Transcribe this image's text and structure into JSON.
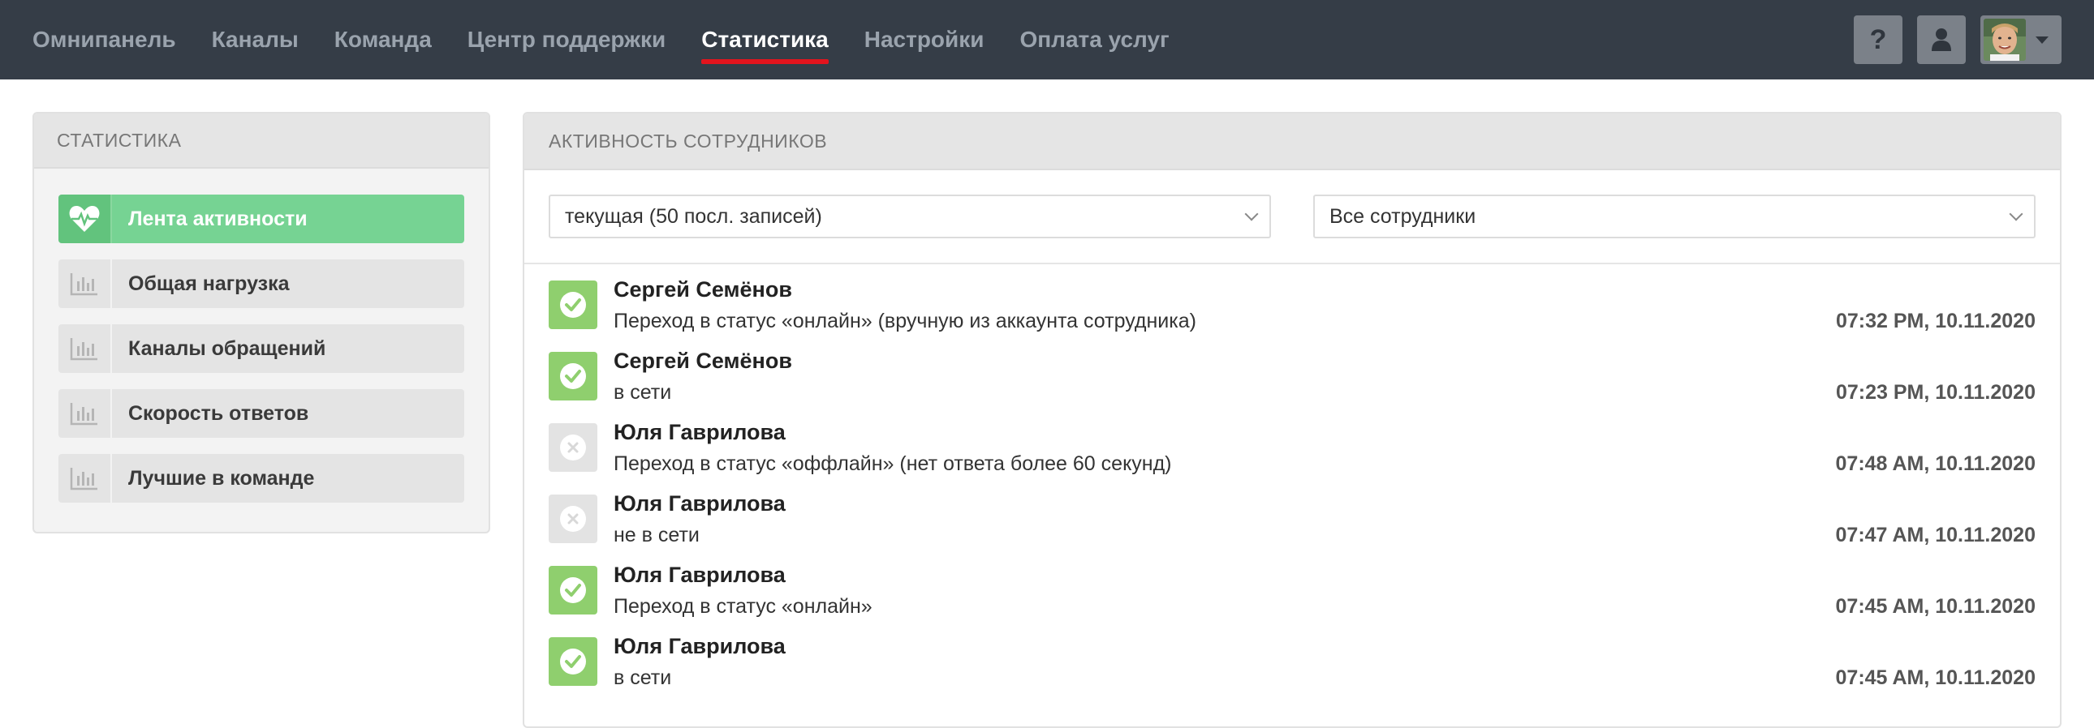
{
  "nav": {
    "items": [
      {
        "label": "Омнипанель"
      },
      {
        "label": "Каналы"
      },
      {
        "label": "Команда"
      },
      {
        "label": "Центр поддержки"
      },
      {
        "label": "Статистика"
      },
      {
        "label": "Настройки"
      },
      {
        "label": "Оплата услуг"
      }
    ],
    "active": "Статистика",
    "help_label": "?"
  },
  "sidebar": {
    "title": "СТАТИСТИКА",
    "items": [
      {
        "label": "Лента активности",
        "icon": "heartbeat-icon",
        "active": true
      },
      {
        "label": "Общая нагрузка",
        "icon": "bar-chart-icon"
      },
      {
        "label": "Каналы обращений",
        "icon": "bar-chart-icon"
      },
      {
        "label": "Скорость ответов",
        "icon": "bar-chart-icon"
      },
      {
        "label": "Лучшие в команде",
        "icon": "bar-chart-icon"
      }
    ]
  },
  "main": {
    "title": "АКТИВНОСТЬ СОТРУДНИКОВ",
    "period_select": "текущая (50 посл. записей)",
    "employee_select": "Все сотрудники",
    "feed": [
      {
        "name": "Сергей Семёнов",
        "event": "Переход в статус «онлайн» (вручную из аккаунта сотрудника)",
        "time": "07:32 PM, 10.11.2020",
        "status": "online"
      },
      {
        "name": "Сергей Семёнов",
        "event": "в сети",
        "time": "07:23 PM, 10.11.2020",
        "status": "online"
      },
      {
        "name": "Юля Гаврилова",
        "event": "Переход в статус «оффлайн» (нет ответа более 60 секунд)",
        "time": "07:48 AM, 10.11.2020",
        "status": "offline"
      },
      {
        "name": "Юля Гаврилова",
        "event": "не в сети",
        "time": "07:47 AM, 10.11.2020",
        "status": "offline"
      },
      {
        "name": "Юля Гаврилова",
        "event": "Переход в статус «онлайн»",
        "time": "07:45 AM, 10.11.2020",
        "status": "online"
      },
      {
        "name": "Юля Гаврилова",
        "event": "в сети",
        "time": "07:45 AM, 10.11.2020",
        "status": "online"
      }
    ]
  },
  "colors": {
    "topbar": "#353d47",
    "active_underline": "#e3141d",
    "active_menu": "#76d393",
    "status_online": "#8fcf6e",
    "status_offline": "#e3e3e3"
  }
}
